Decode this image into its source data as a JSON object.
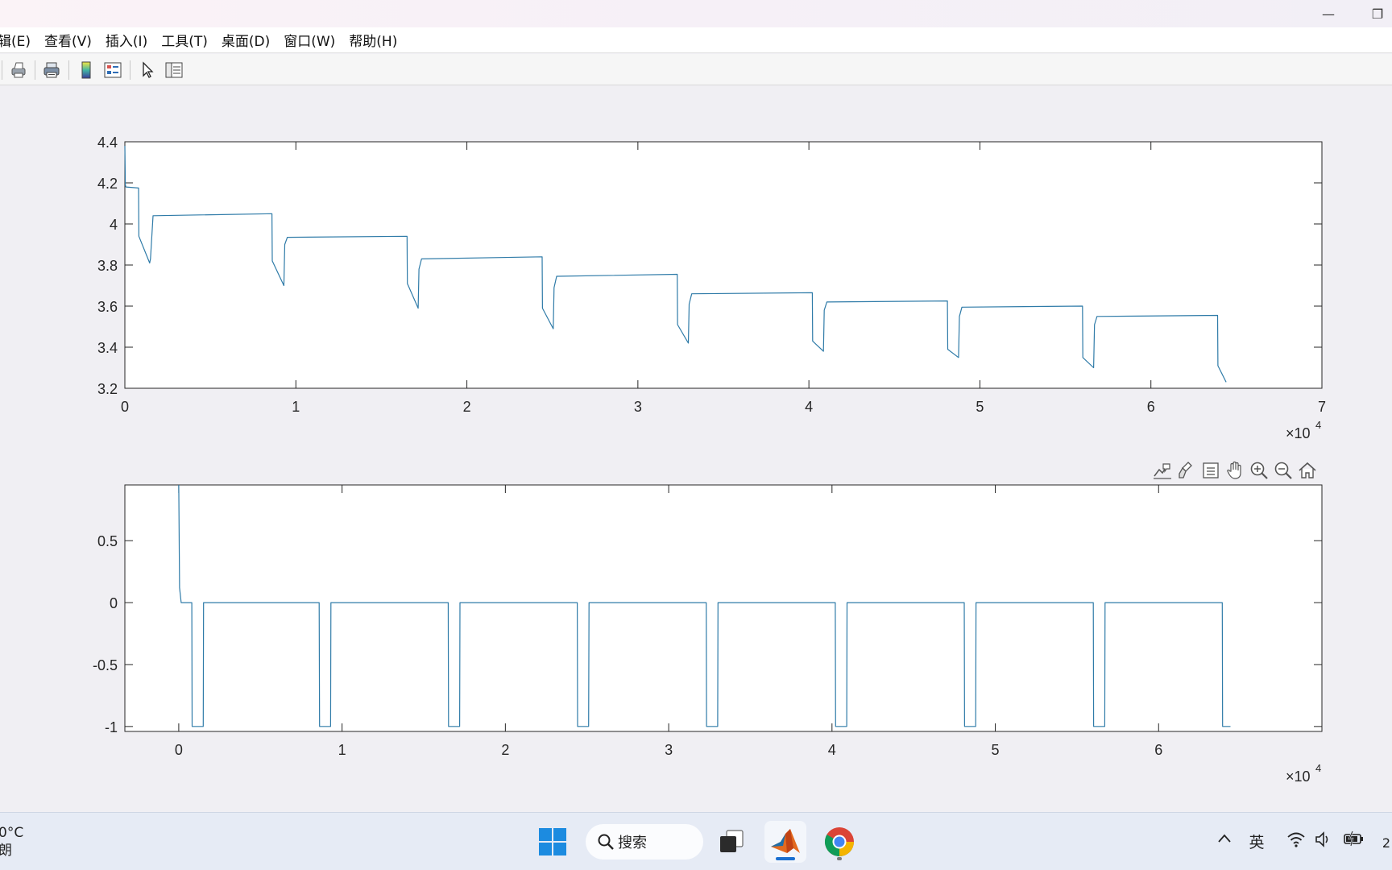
{
  "titlebar": {
    "minimize_glyph": "—",
    "maximize_glyph": "❐"
  },
  "menu": [
    "辑(E)",
    "查看(V)",
    "插入(I)",
    "工具(T)",
    "桌面(D)",
    "窗口(W)",
    "帮助(H)"
  ],
  "toolbar_icons": [
    "print-icon",
    "print-preview-icon",
    "colorbar-icon",
    "legend-icon",
    "edit-plot-icon",
    "property-inspector-icon"
  ],
  "axes_toolbar_icons": [
    "data-tip-icon",
    "brush-icon",
    "export-icon",
    "pan-icon",
    "zoom-in-icon",
    "zoom-out-icon",
    "restore-view-icon"
  ],
  "chart_data": [
    {
      "type": "line",
      "xlim": [
        0,
        70000
      ],
      "ylim": [
        3.2,
        4.4
      ],
      "xticks": [
        0,
        1,
        2,
        3,
        4,
        5,
        6,
        7
      ],
      "yticks": [
        "3.2",
        "3.4",
        "3.6",
        "3.8",
        "4",
        "4.2",
        "4.4"
      ],
      "x_multiplier_base": "×10",
      "x_multiplier_exp": "4",
      "color": "#2f7ba8",
      "series": [
        {
          "x": [
            0,
            30,
            60,
            800,
            820,
            1450,
            1500,
            1650,
            8600,
            8620,
            9300,
            9350,
            9500,
            16500,
            16520,
            17150,
            17200,
            17350,
            24400,
            24420,
            25050,
            25100,
            25250,
            32300,
            32320,
            32950,
            33000,
            33150,
            40200,
            40220,
            40850,
            40900,
            41050,
            48100,
            48120,
            48750,
            48800,
            48950,
            56000,
            56020,
            56650,
            56700,
            56850,
            63900,
            63920,
            64400
          ],
          "y": [
            4.38,
            4.19,
            4.18,
            4.175,
            3.94,
            3.81,
            3.83,
            4.04,
            4.05,
            3.82,
            3.7,
            3.9,
            3.935,
            3.94,
            3.71,
            3.59,
            3.78,
            3.83,
            3.84,
            3.59,
            3.49,
            3.69,
            3.745,
            3.755,
            3.51,
            3.42,
            3.61,
            3.66,
            3.665,
            3.43,
            3.38,
            3.58,
            3.62,
            3.625,
            3.39,
            3.35,
            3.55,
            3.595,
            3.6,
            3.35,
            3.3,
            3.51,
            3.55,
            3.555,
            3.31,
            3.23
          ]
        }
      ]
    },
    {
      "type": "line",
      "xlim": [
        -3300,
        70000
      ],
      "ylim": [
        -1.04,
        0.95
      ],
      "xticks": [
        0,
        1,
        2,
        3,
        4,
        5,
        6
      ],
      "yticks": [
        "-1",
        "-0.5",
        "0",
        "0.5"
      ],
      "x_multiplier_base": "×10",
      "x_multiplier_exp": "4",
      "color": "#2f7ba8",
      "series": [
        {
          "x": [
            0,
            50,
            150,
            800,
            820,
            1500,
            1520,
            8600,
            8620,
            9300,
            9320,
            16500,
            16520,
            17200,
            17220,
            24400,
            24420,
            25100,
            25120,
            32300,
            32320,
            33000,
            33020,
            40200,
            40220,
            40900,
            40920,
            48100,
            48120,
            48800,
            48820,
            56000,
            56020,
            56700,
            56720,
            63900,
            63920,
            64400
          ],
          "y": [
            0.95,
            0.12,
            0,
            0,
            -1,
            -1,
            0,
            0,
            -1,
            -1,
            0,
            0,
            -1,
            -1,
            0,
            0,
            -1,
            -1,
            0,
            0,
            -1,
            -1,
            0,
            0,
            -1,
            -1,
            0,
            0,
            -1,
            -1,
            0,
            0,
            -1,
            -1,
            0,
            0,
            -1,
            -1
          ]
        }
      ]
    }
  ],
  "taskbar": {
    "weather_temp": "0°C",
    "weather_cond": "朗",
    "search_label": "搜索",
    "ime_label": "英",
    "clock_partial": "2"
  }
}
